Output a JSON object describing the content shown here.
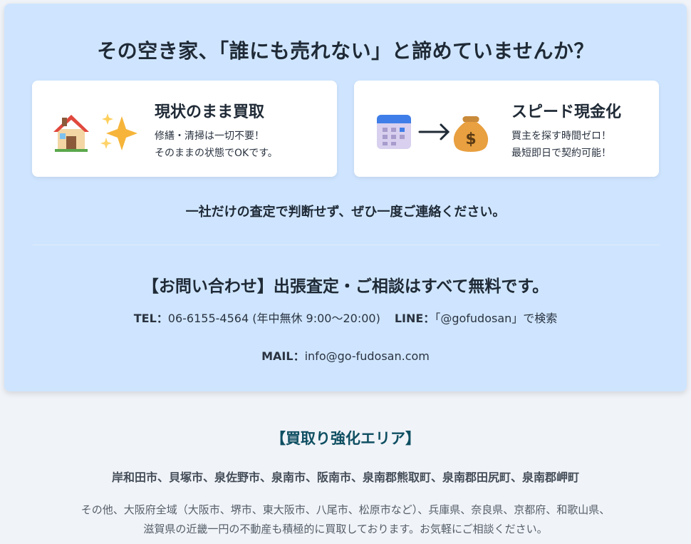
{
  "hero": {
    "headline": "その空き家、「誰にも売れない」と諦めていませんか？",
    "cards": [
      {
        "title": "現状のまま買取",
        "lines": [
          "修繕・清掃は一切不要！",
          "そのままの状態でOKです。"
        ],
        "icons": [
          "house-icon",
          "sparkles-icon"
        ]
      },
      {
        "title": "スピード現金化",
        "lines": [
          "買主を探す時間ゼロ！",
          "最短即日で契約可能！"
        ],
        "icons": [
          "calendar-icon",
          "arrow-right-icon",
          "money-bag-icon"
        ]
      }
    ],
    "sub_message": "一社だけの査定で判断せず、ぜひ一度ご連絡ください。"
  },
  "contact": {
    "title": "【お問い合わせ】出張査定・ご相談はすべて無料です。",
    "tel_label": "TEL：",
    "tel_value": "06-6155-4564 (年中無休 9:00〜20:00)",
    "line_label": "LINE：",
    "line_value": "「@gofudosan」で検索",
    "mail_label": "MAIL：",
    "mail_value": "info@go-fudosan.com"
  },
  "area": {
    "title": "【買取り強化エリア】",
    "main": "岸和田市、貝塚市、泉佐野市、泉南市、阪南市、泉南郡熊取町、泉南郡田尻町、泉南郡岬町",
    "desc_line1": "その他、大阪府全域（大阪市、堺市、東大阪市、八尾市、松原市など）、兵庫県、奈良県、京都府、和歌山県、",
    "desc_line2": "滋賀県の近畿一円の不動産も積極的に買取しております。お気軽にご相談ください。"
  },
  "colors": {
    "hero_bg": "#cfe5ff",
    "page_bg": "#f0f3f8",
    "area_title": "#0f4f62"
  }
}
